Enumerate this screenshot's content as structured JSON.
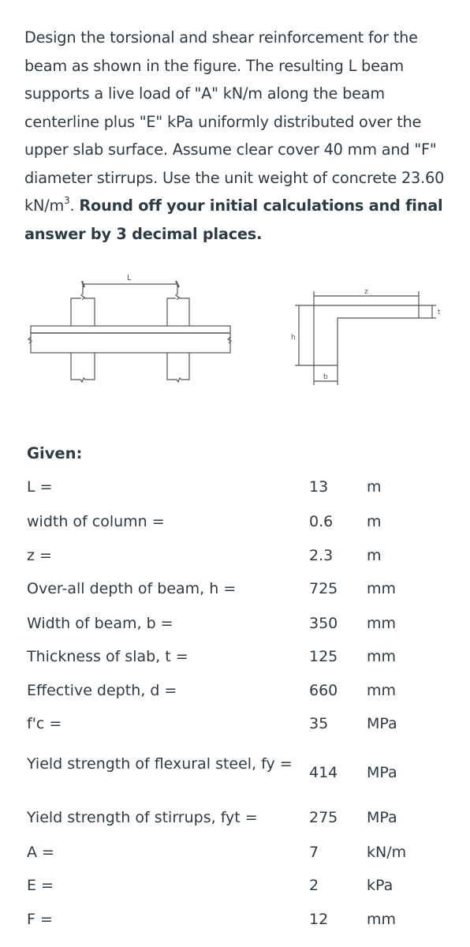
{
  "problem": {
    "text_plain": "Design the torsional and shear reinforcement for the beam as shown in the figure. The resulting L beam supports a live load of \"A\" kN/m along the beam centerline plus \"E\" kPa uniformly distributed over the upper slab surface. Assume clear cover 40 mm and \"F\" diameter stirrups. Use the unit weight of concrete 23.60 kN/m",
    "superscript": "3",
    "after_sup": ". ",
    "text_bold": "Round off your initial calculations and final answer by 3 decimal places."
  },
  "figure": {
    "elevation": {
      "span_label": "L"
    },
    "section": {
      "z_label": "z",
      "h_label": "h",
      "b_label": "b",
      "t_label": "t"
    }
  },
  "given": {
    "title": "Given:",
    "rows": [
      {
        "label": "L =",
        "value": "13",
        "unit": "m"
      },
      {
        "label": "width of column =",
        "value": "0.6",
        "unit": "m"
      },
      {
        "label": "z =",
        "value": "2.3",
        "unit": "m"
      },
      {
        "label": "Over-all depth of beam, h =",
        "value": "725",
        "unit": "mm"
      },
      {
        "label": "Width of beam, b =",
        "value": "350",
        "unit": "mm"
      },
      {
        "label": "Thickness of slab, t =",
        "value": "125",
        "unit": "mm"
      },
      {
        "label": "Effective depth, d =",
        "value": "660",
        "unit": "mm"
      },
      {
        "label": "f'c =",
        "value": "35",
        "unit": "MPa"
      },
      {
        "label": "Yield strength of flexural steel, fy =",
        "value": "414",
        "unit": "MPa"
      },
      {
        "label": "Yield strength of stirrups, fyt =",
        "value": "275",
        "unit": "MPa"
      },
      {
        "label": "A =",
        "value": "7",
        "unit": "kN/m"
      },
      {
        "label": "E =",
        "value": "2",
        "unit": "kPa"
      },
      {
        "label": "F =",
        "value": "12",
        "unit": "mm"
      }
    ]
  }
}
